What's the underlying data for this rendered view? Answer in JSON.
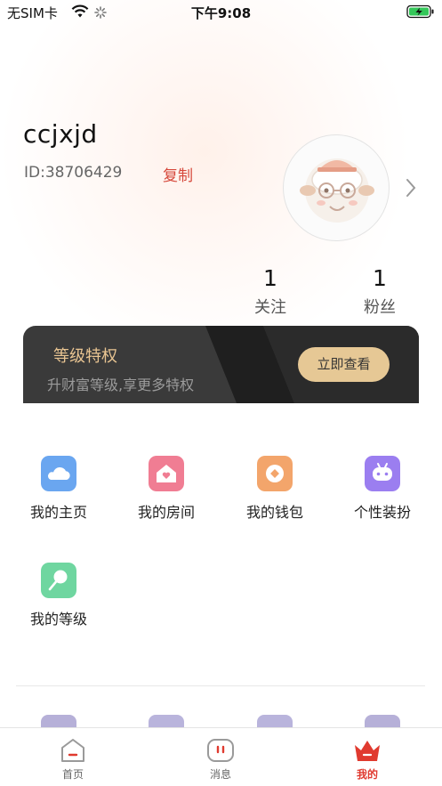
{
  "status_bar": {
    "carrier": "无SIM卡",
    "time": "下午9:08"
  },
  "profile": {
    "username": "ccjxjd",
    "id_text": "ID:38706429",
    "copy_label": "复制",
    "stats": [
      {
        "value": "1",
        "label": "关注"
      },
      {
        "value": "1",
        "label": "粉丝"
      }
    ]
  },
  "vip_card": {
    "title": "等级特权",
    "subtitle": "升财富等级,享更多特权",
    "button": "立即查看"
  },
  "menu": {
    "items": [
      {
        "label": "我的主页",
        "icon": "cloud-icon",
        "color": "#6aa6f0"
      },
      {
        "label": "我的房间",
        "icon": "house-heart-icon",
        "color": "#f07d93"
      },
      {
        "label": "我的钱包",
        "icon": "coin-icon",
        "color": "#f3a56b"
      },
      {
        "label": "个性装扮",
        "icon": "gamepad-icon",
        "color": "#9b7ef0"
      },
      {
        "label": "我的等级",
        "icon": "lollipop-icon",
        "color": "#6fd6a0"
      }
    ]
  },
  "tabs": [
    {
      "label": "首页",
      "icon": "home-icon"
    },
    {
      "label": "消息",
      "icon": "message-icon"
    },
    {
      "label": "我的",
      "icon": "crown-icon",
      "active": true
    }
  ],
  "colors": {
    "accent": "#e03a2f",
    "vip_gold": "#e6c895",
    "vip_bg": "#3a3a3a"
  }
}
